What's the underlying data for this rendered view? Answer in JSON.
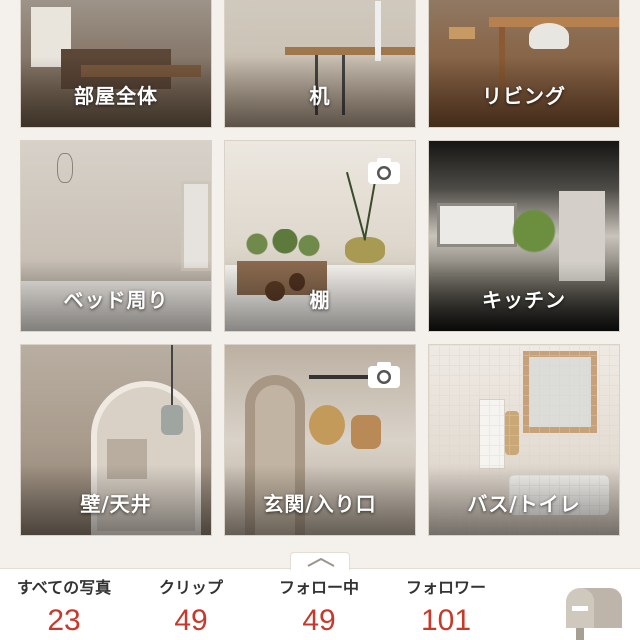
{
  "categories": [
    {
      "label": "部屋全体"
    },
    {
      "label": "机"
    },
    {
      "label": "リビング"
    },
    {
      "label": "ベッド周り"
    },
    {
      "label": "棚"
    },
    {
      "label": "キッチン"
    },
    {
      "label": "壁/天井"
    },
    {
      "label": "玄関/入り口"
    },
    {
      "label": "バス/トイレ"
    }
  ],
  "stats": {
    "photos": {
      "label": "すべての写真",
      "value": "23"
    },
    "clips": {
      "label": "クリップ",
      "value": "49"
    },
    "following": {
      "label": "フォロー中",
      "value": "49"
    },
    "followers": {
      "label": "フォロワー",
      "value": "101"
    }
  },
  "icons": {
    "camera": "camera-icon",
    "expand": "chevron-up-icon",
    "mailbox": "mailbox-icon"
  },
  "colors": {
    "background": "#f4f1ec",
    "stat_value": "#c7392b",
    "stat_label": "#333333"
  }
}
